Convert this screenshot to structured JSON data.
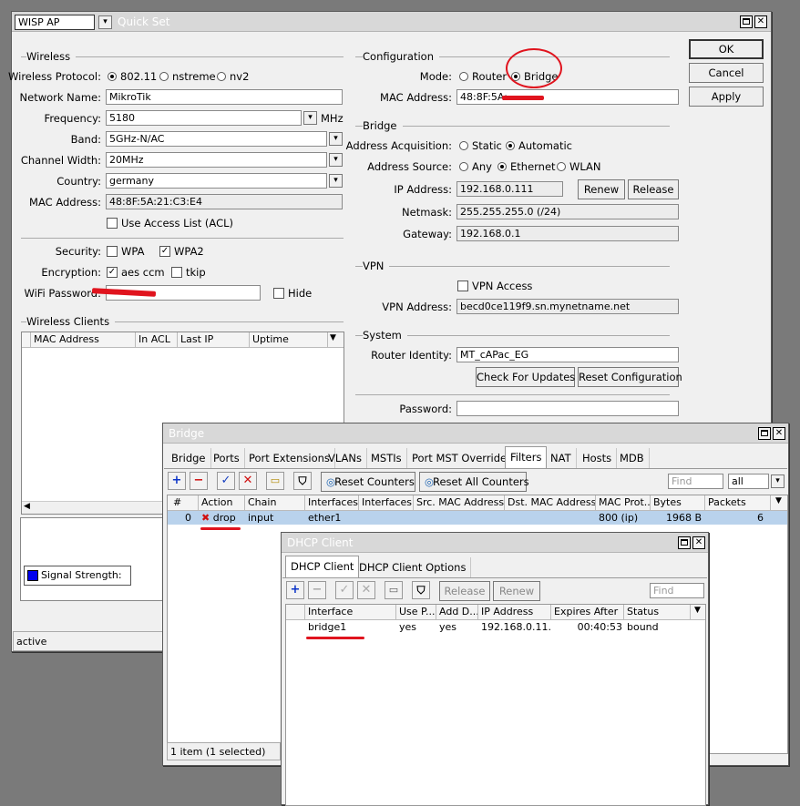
{
  "main": {
    "mode_select": "WISP AP",
    "title": "Quick Set",
    "buttons": {
      "ok": "OK",
      "cancel": "Cancel",
      "apply": "Apply"
    },
    "wireless": {
      "section": "Wireless",
      "protocol_label": "Wireless Protocol:",
      "protocols": [
        "802.11",
        "nstreme",
        "nv2"
      ],
      "protocol_selected": "802.11",
      "network_name_label": "Network Name:",
      "network_name": "MikroTik",
      "frequency_label": "Frequency:",
      "frequency": "5180",
      "frequency_unit": "MHz",
      "band_label": "Band:",
      "band": "5GHz-N/AC",
      "channel_width_label": "Channel Width:",
      "channel_width": "20MHz",
      "country_label": "Country:",
      "country": "germany",
      "mac_label": "MAC Address:",
      "mac": "48:8F:5A:21:C3:E4",
      "acl_label": "Use Access List (ACL)",
      "security_label": "Security:",
      "security_wpa": "WPA",
      "security_wpa2": "WPA2",
      "encryption_label": "Encryption:",
      "enc_aes": "aes ccm",
      "enc_tkip": "tkip",
      "wifi_password_label": "WiFi Password:",
      "hide_label": "Hide"
    },
    "clients": {
      "section": "Wireless Clients",
      "columns": [
        "MAC Address",
        "In ACL",
        "Last IP",
        "Uptime"
      ],
      "signal_label": "Signal Strength:"
    },
    "status": "active",
    "configuration": {
      "section": "Configuration",
      "mode_label": "Mode:",
      "mode_router": "Router",
      "mode_bridge": "Bridge",
      "mac_label": "MAC Address:",
      "mac": "48:8F:5A:"
    },
    "bridge": {
      "section": "Bridge",
      "acq_label": "Address Acquisition:",
      "acq_static": "Static",
      "acq_auto": "Automatic",
      "source_label": "Address Source:",
      "source_any": "Any",
      "source_ethernet": "Ethernet",
      "source_wlan": "WLAN",
      "ip_label": "IP Address:",
      "ip": "192.168.0.111",
      "renew": "Renew",
      "release": "Release",
      "netmask_label": "Netmask:",
      "netmask": "255.255.255.0 (/24)",
      "gateway_label": "Gateway:",
      "gateway": "192.168.0.1"
    },
    "vpn": {
      "section": "VPN",
      "access_label": "VPN Access",
      "address_label": "VPN Address:",
      "address": "becd0ce119f9.sn.mynetname.net"
    },
    "system": {
      "section": "System",
      "identity_label": "Router Identity:",
      "identity": "MT_cAPac_EG",
      "check_updates": "Check For Updates",
      "reset_config": "Reset Configuration",
      "password_label": "Password:"
    }
  },
  "bridge_win": {
    "title": "Bridge",
    "tabs": [
      "Bridge",
      "Ports",
      "Port Extensions",
      "VLANs",
      "MSTIs",
      "Port MST Overrides",
      "Filters",
      "NAT",
      "Hosts",
      "MDB"
    ],
    "active_tab": "Filters",
    "reset_counters": "Reset Counters",
    "reset_all_counters": "Reset All Counters",
    "find_placeholder": "Find",
    "filter_select": "all",
    "columns": [
      "#",
      "Action",
      "Chain",
      "Interfaces...",
      "Interfaces...",
      "Src. MAC Address...",
      "Dst. MAC Address...",
      "MAC Prot...",
      "Bytes",
      "Packets"
    ],
    "row": {
      "num": "0",
      "action": "drop",
      "chain": "input",
      "iface": "ether1",
      "mac_proto": "800 (ip)",
      "bytes": "1968 B",
      "packets": "6"
    },
    "status": "1 item (1 selected)"
  },
  "dhcp_win": {
    "title": "DHCP Client",
    "tabs": [
      "DHCP Client",
      "DHCP Client Options"
    ],
    "release": "Release",
    "renew": "Renew",
    "find_placeholder": "Find",
    "columns": [
      "Interface",
      "Use P...",
      "Add D...",
      "IP Address",
      "Expires After",
      "Status"
    ],
    "row": {
      "iface": "bridge1",
      "use_peer": "yes",
      "add_default": "yes",
      "ip": "192.168.0.11...",
      "expires": "00:40:53",
      "status": "bound"
    }
  },
  "colors": {
    "accent": "#0000ee",
    "selection": "#b9d2ec",
    "annotation": "#e0141e"
  }
}
